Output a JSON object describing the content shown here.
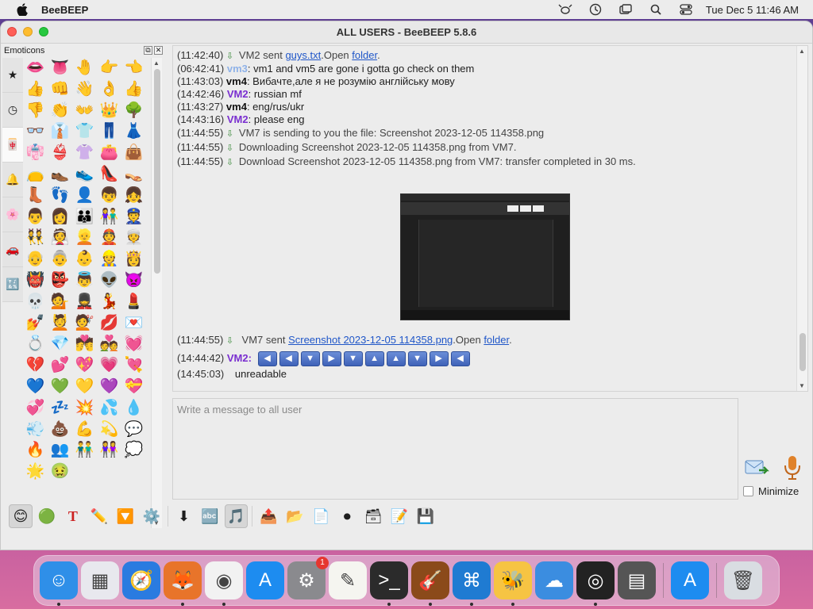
{
  "menubar": {
    "app_name": "BeeBEEP",
    "clock": "Tue Dec 5  11:46 AM"
  },
  "window": {
    "title": "ALL USERS - BeeBEEP 5.8.6"
  },
  "emoticons": {
    "title": "Emoticons",
    "tabs": [
      "★",
      "◷",
      "🀄",
      "🔔",
      "🌸",
      "🚗",
      "🔣"
    ],
    "grid": [
      "👄",
      "👅",
      "🤚",
      "👉",
      "👈",
      "👍",
      "👊",
      "👋",
      "👌",
      "👍",
      "👎",
      "👏",
      "👐",
      "👑",
      "🌳",
      "👓",
      "👔",
      "👕",
      "👖",
      "👗",
      "👘",
      "👙",
      "👚",
      "👛",
      "👜",
      "👝",
      "👞",
      "👟",
      "👠",
      "👡",
      "👢",
      "👣",
      "👤",
      "👦",
      "👧",
      "👨",
      "👩",
      "👪",
      "👫",
      "👮",
      "👯",
      "👰",
      "👱",
      "👲",
      "👳",
      "👴",
      "👵",
      "👶",
      "👷",
      "👸",
      "👹",
      "👺",
      "👼",
      "👽",
      "👿",
      "💀",
      "💁",
      "💂",
      "💃",
      "💄",
      "💅",
      "💆",
      "💇",
      "💋",
      "💌",
      "💍",
      "💎",
      "💏",
      "💑",
      "💓",
      "💔",
      "💕",
      "💖",
      "💗",
      "💘",
      "💙",
      "💚",
      "💛",
      "💜",
      "💝",
      "💞",
      "💤",
      "💥",
      "💦",
      "💧",
      "💨",
      "💩",
      "💪",
      "💫",
      "💬",
      "🔥",
      "👥",
      "👬",
      "👭",
      "💭",
      "🌟",
      "🤢"
    ]
  },
  "chat": {
    "lines": [
      {
        "ts": "(11:42:40)",
        "type": "sys",
        "icon": true,
        "pre": "VM2 sent ",
        "link": "guys.txt",
        "mid": ".Open ",
        "link2": "folder",
        "post": "."
      },
      {
        "ts": "(06:42:41)",
        "type": "msg",
        "user": "vm3",
        "user_class": "vm3",
        "text": ": vm1 and vm5 are gone i gotta go check on them"
      },
      {
        "ts": "(11:43:03)",
        "type": "msg",
        "user": "vm4",
        "user_class": "",
        "text": ": Вибачте,але я не розумію англійську мову"
      },
      {
        "ts": "(14:42:46)",
        "type": "msg",
        "user": "VM2",
        "user_class": "vm2",
        "text": ": russian mf"
      },
      {
        "ts": "(11:43:27)",
        "type": "msg",
        "user": "vm4",
        "user_class": "",
        "text": ": eng/rus/ukr"
      },
      {
        "ts": "(14:43:16)",
        "type": "msg",
        "user": "VM2",
        "user_class": "vm2",
        "text": ": please eng"
      },
      {
        "ts": "(11:44:55)",
        "type": "sys",
        "icon": true,
        "pre": "VM7 is sending to you the file: Screenshot 2023-12-05 114358.png"
      },
      {
        "ts": "(11:44:55)",
        "type": "sys",
        "icon": true,
        "pre": "Downloading Screenshot 2023-12-05 114358.png from VM7."
      },
      {
        "ts": "(11:44:55)",
        "type": "sys",
        "icon": true,
        "pre": "Download Screenshot 2023-12-05 114358.png from VM7: transfer completed in 30 ms."
      }
    ],
    "sent_line": {
      "ts": "(11:44:55)",
      "pre": "VM7 sent ",
      "link": "Screenshot 2023-12-05 114358.png",
      "mid": ".Open ",
      "link2": "folder",
      "post": "."
    },
    "vm2_line": {
      "ts": "(14:44:42)",
      "user": "VM2",
      "suffix": ":"
    },
    "nav_buttons": [
      "◀",
      "◀",
      "▼",
      "▶",
      "▼",
      "▲",
      "▲",
      "▼",
      "▶",
      "◀"
    ],
    "last_line": {
      "ts": "(14:45:03)",
      "text": "unreadable"
    }
  },
  "input": {
    "placeholder": "Write a message to all user",
    "value": ""
  },
  "minimize_label": "Minimize",
  "toolbar": {
    "items": [
      "😊",
      "🟢",
      "T",
      "✏️",
      "🔽",
      "⚙️",
      "⬇",
      "🔤",
      "🎵",
      "📤",
      "📂",
      "📄",
      "⏺",
      "🗃",
      "📝",
      "💾"
    ]
  },
  "dock": {
    "items": [
      "Finder",
      "Launchpad",
      "Safari",
      "Firefox",
      "Chrome",
      "App Store",
      "System Settings",
      "TextEdit",
      "Terminal",
      "GarageBand",
      "VS Code",
      "BeeBEEP",
      "Weather",
      "OBS",
      "Calculator",
      "App Store 2",
      "Trash"
    ],
    "settings_badge": "1"
  }
}
